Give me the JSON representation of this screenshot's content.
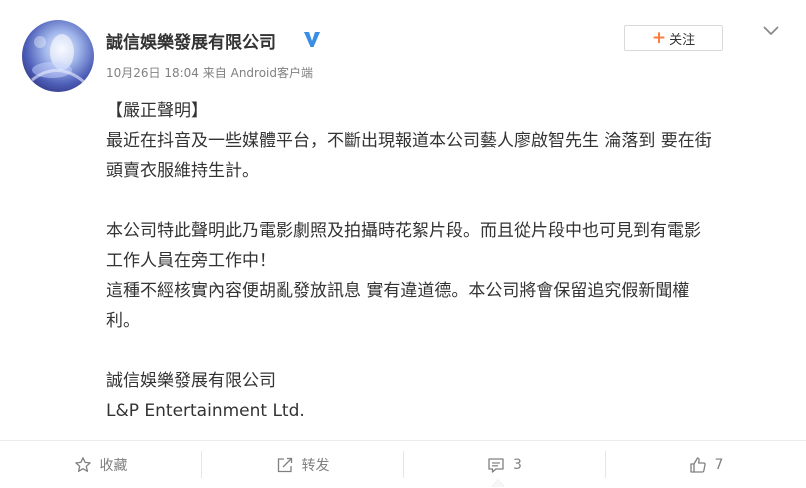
{
  "post": {
    "author": {
      "name": "誠信娛樂發展有限公司",
      "verified": true
    },
    "meta": {
      "time": "10月26日 18:04",
      "source_prefix": "来自",
      "source": "Android客户端"
    },
    "follow_button": {
      "icon": "plus-icon",
      "label": "关注"
    },
    "more_icon": "chevron-down-icon",
    "content": {
      "heading": "【嚴正聲明】",
      "lines": [
        "最近在抖音及一些媒體平台，不斷出現報道本公司藝人廖啟智先生 淪落到 要在街",
        "頭賣衣服維持生計。",
        "",
        "本公司特此聲明此乃電影劇照及拍攝時花絮片段。而且從片段中也可見到有電影",
        "工作人員在旁工作中！",
        "這種不經核實內容便胡亂發放訊息 實有違道德。本公司將會保留追究假新聞權",
        "利。",
        "",
        "誠信娛樂發展有限公司",
        "L&P Entertainment Ltd."
      ]
    },
    "actions": {
      "favorite": {
        "icon": "star-icon",
        "label": "收藏"
      },
      "repost": {
        "icon": "share-icon",
        "label": "转发"
      },
      "comment": {
        "icon": "comment-icon",
        "count": "3"
      },
      "like": {
        "icon": "thumbs-up-icon",
        "count": "7"
      }
    }
  },
  "colors": {
    "text": "#333333",
    "meta": "#808080",
    "accent": "#fa7d3c",
    "verified": "#3a8ee6",
    "divider": "#ececec"
  }
}
